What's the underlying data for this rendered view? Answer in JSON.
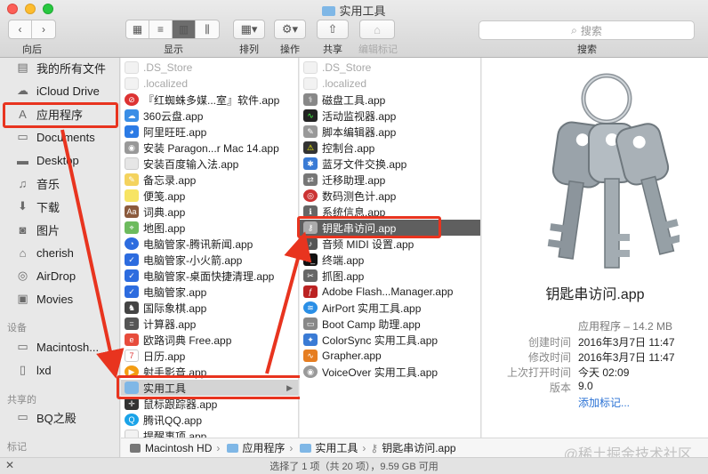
{
  "window": {
    "title": "实用工具"
  },
  "toolbar": {
    "back_label": "向后",
    "view_label": "显示",
    "arrange_label": "排列",
    "action_label": "操作",
    "share_label": "共享",
    "tags_label": "编辑标记",
    "search_label": "搜索",
    "search_placeholder": "搜索"
  },
  "sidebar": {
    "items": [
      {
        "label": "我的所有文件",
        "icon": "all-files-icon"
      },
      {
        "label": "iCloud Drive",
        "icon": "cloud-icon"
      },
      {
        "label": "应用程序",
        "icon": "applications-icon"
      },
      {
        "label": "Documents",
        "icon": "documents-icon"
      },
      {
        "label": "Desktop",
        "icon": "desktop-icon"
      },
      {
        "label": "音乐",
        "icon": "music-icon"
      },
      {
        "label": "下载",
        "icon": "download-icon"
      },
      {
        "label": "图片",
        "icon": "camera-icon"
      },
      {
        "label": "cherish",
        "icon": "home-icon"
      },
      {
        "label": "AirDrop",
        "icon": "airdrop-icon"
      },
      {
        "label": "Movies",
        "icon": "movies-icon"
      }
    ],
    "devices_header": "设备",
    "devices": [
      {
        "label": "Macintosh...",
        "icon": "disk-icon"
      },
      {
        "label": "lxd",
        "icon": "disk-icon"
      }
    ],
    "shared_header": "共享的",
    "shared": [
      {
        "label": "BQ之殿",
        "icon": "monitor-icon"
      }
    ],
    "tags_header": "标记"
  },
  "column1": {
    "items": [
      ".DS_Store",
      ".localized",
      "『红蜘蛛多媒...室』软件.app",
      "360云盘.app",
      "阿里旺旺.app",
      "安装 Paragon...r Mac 14.app",
      "安装百度输入法.app",
      "备忘录.app",
      "便笺.app",
      "词典.app",
      "地图.app",
      "电脑管家-腾讯新闻.app",
      "电脑管家-小火箭.app",
      "电脑管家-桌面快捷清理.app",
      "电脑管家.app",
      "国际象棋.app",
      "计算器.app",
      "欧路词典 Free.app",
      "日历.app",
      "射手影音.app",
      "实用工具",
      "鼠标跟踪器.app",
      "腾讯QQ.app",
      "提醒事项.app"
    ]
  },
  "column2": {
    "items": [
      ".DS_Store",
      ".localized",
      "磁盘工具.app",
      "活动监视器.app",
      "脚本编辑器.app",
      "控制台.app",
      "蓝牙文件交换.app",
      "迁移助理.app",
      "数码测色计.app",
      "系统信息.app",
      "钥匙串访问.app",
      "音频 MIDI 设置.app",
      "终端.app",
      "抓图.app",
      "Adobe Flash...Manager.app",
      "AirPort 实用工具.app",
      "Boot Camp 助理.app",
      "ColorSync 实用工具.app",
      "Grapher.app",
      "VoiceOver 实用工具.app"
    ]
  },
  "preview": {
    "name": "钥匙串访问.app",
    "kind": "应用程序 – 14.2 MB",
    "meta": [
      {
        "key": "创建时间",
        "value": "2016年3月7日 11:47"
      },
      {
        "key": "修改时间",
        "value": "2016年3月7日 11:47"
      },
      {
        "key": "上次打开时间",
        "value": "今天 02:09"
      },
      {
        "key": "版本",
        "value": "9.0"
      }
    ],
    "add_tags": "添加标记..."
  },
  "pathbar": {
    "segments": [
      "Macintosh HD",
      "应用程序",
      "实用工具",
      "钥匙串访问.app"
    ]
  },
  "statusbar": {
    "text": "选择了 1 项（共 20 项），9.59 GB 可用"
  },
  "watermark": "@稀土掘金技术社区",
  "colors": {
    "annotation_red": "#e8341f",
    "selection_gray": "#5f5f5f",
    "link_blue": "#2a72d5"
  }
}
